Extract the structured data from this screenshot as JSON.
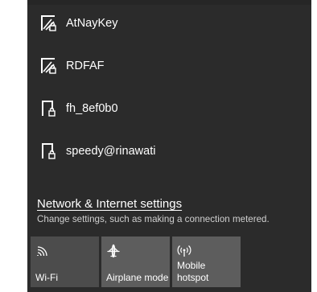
{
  "networks": [
    {
      "name": "AtNayKey",
      "icon": "wifi-secured-icon"
    },
    {
      "name": "RDFAF",
      "icon": "wifi-secured-icon"
    },
    {
      "name": "fh_8ef0b0",
      "icon": "wifi-weak-secured-icon"
    },
    {
      "name": "speedy@rinawati",
      "icon": "wifi-weak-secured-icon"
    }
  ],
  "settings": {
    "link": "Network & Internet settings",
    "description": "Change settings, such as making a connection metered."
  },
  "quick_actions": [
    {
      "label": "Wi-Fi",
      "icon": "wifi-icon"
    },
    {
      "label": "Airplane mode",
      "icon": "airplane-icon"
    },
    {
      "label": "Mobile\nhotspot",
      "icon": "hotspot-icon"
    }
  ],
  "colors": {
    "flyout_bg": "#2b2b2b",
    "tile_bg": "#4c4c4c",
    "text": "#ffffff",
    "subtext": "#cfcfcf"
  }
}
